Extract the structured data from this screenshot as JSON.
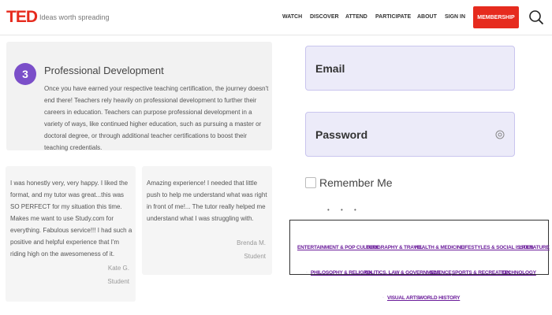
{
  "header": {
    "logo": "TED",
    "tagline": "Ideas worth spreading",
    "nav": [
      "WATCH",
      "DISCOVER",
      "ATTEND",
      "PARTICIPATE",
      "ABOUT",
      "SIGN IN"
    ],
    "membership": "MEMBERSHIP",
    "accent_color": "#e62b1e"
  },
  "card": {
    "number": "3",
    "title": "Professional Development",
    "body": "Once you have earned your respective teaching certification, the journey doesn't end there! Teachers rely heavily on professional development to further their careers in education. Teachers can purpose professional development in a variety of ways, like continued higher education, such as pursuing a master or doctoral degree, or through additional teacher certifications to boost their teaching credentials."
  },
  "testimonials": [
    {
      "text": "I was honestly very, very happy. I liked the format, and my tutor was great...this was SO PERFECT for my situation this time. Makes me want to use Study.com for everything. Fabulous service!!! I had such a positive and helpful experience that I'm riding high on the awesomeness of it.",
      "name": "Kate G.",
      "role": "Student"
    },
    {
      "text": "Amazing experience! I needed that little push to help me understand what was right in front of me!... The tutor really helped me understand what I was struggling with.",
      "name": "Brenda M.",
      "role": "Student"
    }
  ],
  "form": {
    "email_label": "Email",
    "password_label": "Password",
    "remember_label": "Remember Me"
  },
  "topics": {
    "row1": [
      "ENTERTAINMENT & POP CULTURE",
      "GEOGRAPHY & TRAVEL",
      "HEALTH & MEDICINE",
      "LIFESTYLES & SOCIAL ISSUES",
      "LITERATURE"
    ],
    "row2": [
      "PHILOSOPHY & RELIGION",
      "POLITICS, LAW & GOVERNMENT",
      "SCIENCE",
      "SPORTS & RECREATION",
      "TECHNOLOGY"
    ],
    "row3": [
      "VISUAL ARTS",
      "WORLD HISTORY"
    ]
  }
}
